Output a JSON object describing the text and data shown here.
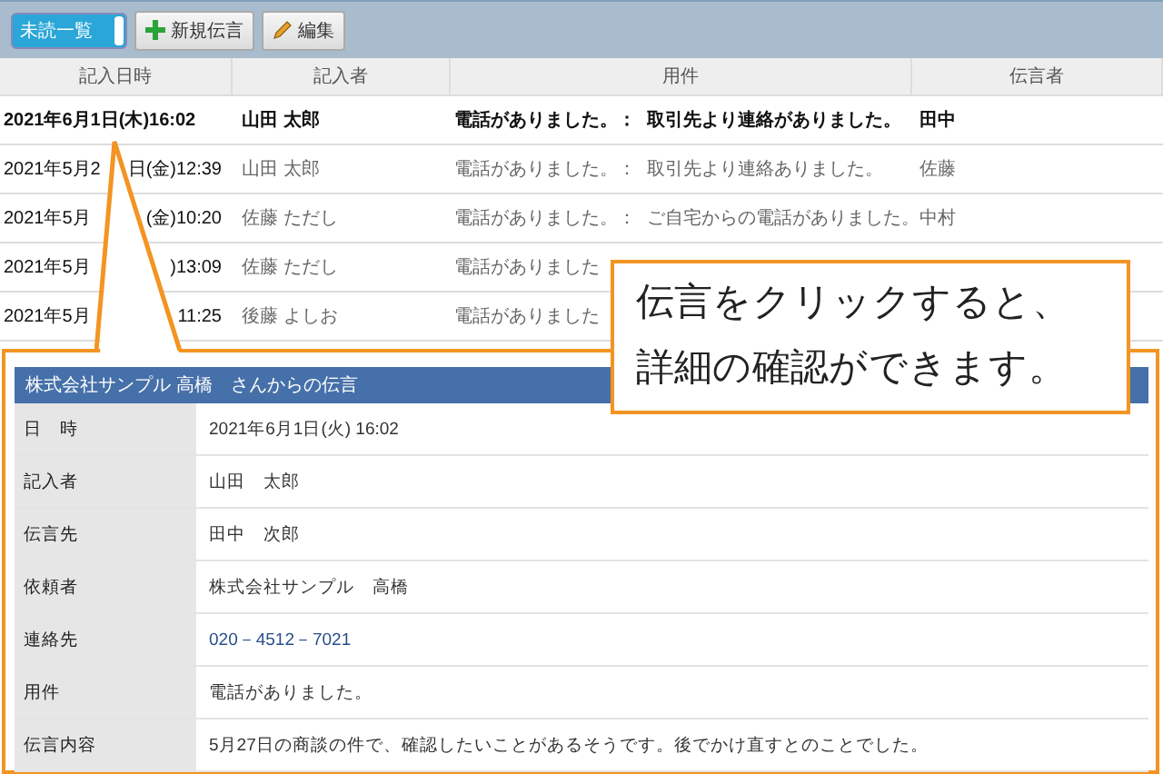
{
  "toolbar": {
    "view_select": "未読一覧",
    "buttons": [
      {
        "kind": "add",
        "label": "新規伝言"
      },
      {
        "kind": "edit",
        "label": "編集"
      }
    ]
  },
  "table": {
    "columns": [
      "記入日時",
      "記入者",
      "用件",
      "伝言者"
    ],
    "rows": [
      {
        "unread": true,
        "date_parts": [
          "2021年6月1日(木)16:02"
        ],
        "author": "山田 太郎",
        "subject": "電話がありました。：",
        "detail": "取引先より連絡がありました。",
        "sender": "田中"
      },
      {
        "unread": false,
        "date_parts": [
          "2021年5月2",
          "日(金)12:39"
        ],
        "author": "山田 太郎",
        "subject": "電話がありました。：",
        "detail": "取引先より連絡ありました。",
        "sender": "佐藤"
      },
      {
        "unread": false,
        "date_parts": [
          "2021年5月",
          "(金)10:20"
        ],
        "author": "佐藤 ただし",
        "subject": "電話がありました。：",
        "detail": "ご自宅からの電話がありました。",
        "sender": "中村"
      },
      {
        "unread": false,
        "date_parts": [
          "2021年5月",
          ")13:09"
        ],
        "author": "佐藤 ただし",
        "subject": "電話がありました"
      },
      {
        "unread": false,
        "date_parts": [
          "2021年5月",
          "11:25"
        ],
        "author": "後藤 よしお",
        "subject": "電話がありました"
      }
    ]
  },
  "detail": {
    "title": "株式会社サンプル 高橋　さんからの伝言",
    "fields": [
      {
        "label": "日　時",
        "value": "2021年6月1日(火) 16:02",
        "kind": "text"
      },
      {
        "label": "記入者",
        "value": "山田　太郎",
        "kind": "text"
      },
      {
        "label": "伝言先",
        "value": "田中　次郎",
        "kind": "text"
      },
      {
        "label": "依頼者",
        "value": "株式会社サンプル　高橋",
        "kind": "text"
      },
      {
        "label": "連絡先",
        "value": "020－4512－7021",
        "kind": "phone"
      },
      {
        "label": "用件",
        "value": "電話がありました。",
        "kind": "text"
      },
      {
        "label": "伝言内容",
        "value": "5月27日の商談の件で、確認したいことがあるそうです。後でかけ直すとのことでした。",
        "kind": "text"
      }
    ]
  },
  "callout": {
    "lines": [
      "伝言をクリックすると、",
      "詳細の確認ができます。"
    ]
  }
}
